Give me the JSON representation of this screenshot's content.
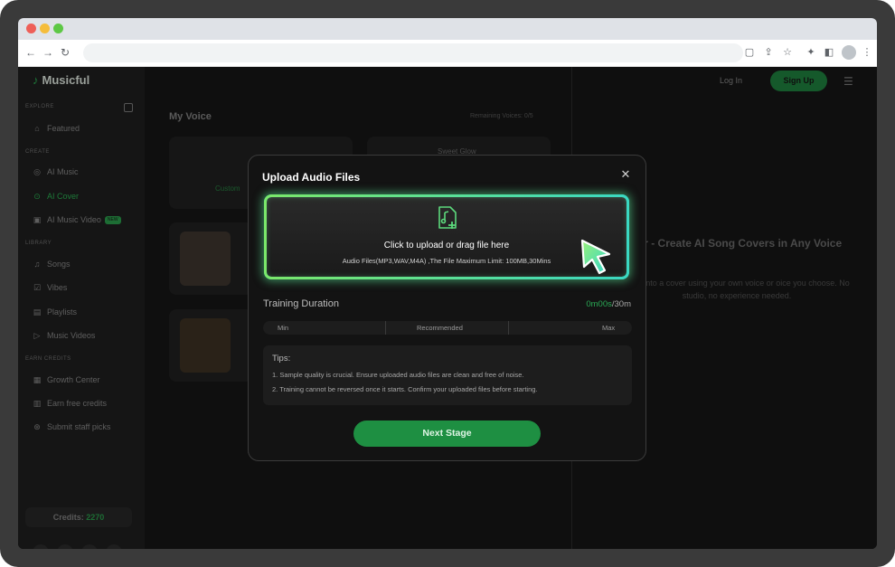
{
  "app": {
    "brand": "Musicful",
    "header": {
      "login_label": "Log In",
      "signup_label": "Sign Up"
    },
    "sidebar": {
      "sections": [
        {
          "title": "EXPLORE",
          "items": [
            {
              "label": "Featured",
              "icon": "home-icon"
            }
          ]
        },
        {
          "title": "CREATE",
          "items": [
            {
              "label": "AI Music",
              "icon": "music-icon"
            },
            {
              "label": "AI Cover",
              "icon": "cover-icon",
              "active": true
            },
            {
              "label": "AI Music Video",
              "icon": "video-icon",
              "badge": "NEW"
            }
          ]
        },
        {
          "title": "LIBRARY",
          "items": [
            {
              "label": "Songs",
              "icon": "song-icon"
            },
            {
              "label": "Vibes",
              "icon": "vibes-icon"
            },
            {
              "label": "Playlists",
              "icon": "playlist-icon"
            },
            {
              "label": "Music Videos",
              "icon": "music-video-icon"
            }
          ]
        },
        {
          "title": "EARN CREDITS",
          "items": [
            {
              "label": "Growth Center",
              "icon": "growth-icon"
            },
            {
              "label": "Earn free credits",
              "icon": "gift-icon"
            },
            {
              "label": "Submit staff picks",
              "icon": "staff-picks-icon"
            }
          ]
        }
      ],
      "credits_label": "Credits:",
      "credits_value": "2270"
    },
    "main": {
      "title": "My Voice",
      "remaining": "Remaining Voices: 0/5",
      "card_custom_label": "Custom",
      "card_voice_name": "Sweet Glow"
    },
    "promo": {
      "title": "ver - Create AI Song Covers in Any Voice",
      "subtitle": "song into a cover using your own voice or oice you choose. No studio, no experience needed."
    }
  },
  "modal": {
    "title": "Upload Audio Files",
    "close_icon": "close-icon",
    "dropzone": {
      "main_text": "Click to upload or drag file here",
      "sub_text": "Audio Files(MP3,WAV,M4A) ,The File Maximum Limit: 100MB,30Mins",
      "icon": "music-file-add-icon",
      "accent_colors": [
        "#7be86a",
        "#3ad8c2"
      ]
    },
    "training_duration": {
      "label": "Training Duration",
      "current": "0m00s",
      "separator": "/",
      "max": "30m",
      "scale_labels": [
        "Min",
        "Recommended",
        "Max"
      ]
    },
    "tips": {
      "title": "Tips:",
      "items": [
        "1. Sample quality is crucial. Ensure uploaded audio files are clean and free of noise.",
        "2. Training cannot be reversed once it starts. Confirm your uploaded files before starting."
      ]
    },
    "next_button_label": "Next Stage",
    "accent_color": "#1e8f42"
  }
}
